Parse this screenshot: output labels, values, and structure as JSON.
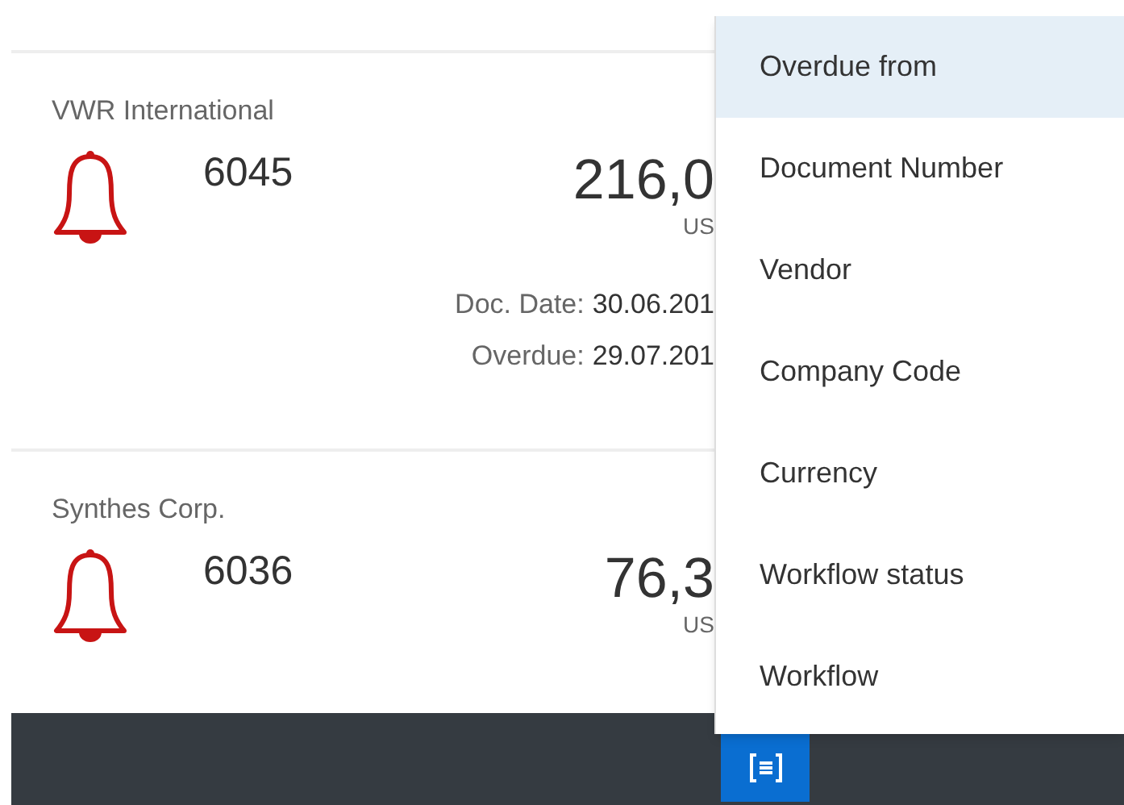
{
  "items": [
    {
      "vendor": "VWR International",
      "number": "6045",
      "amount": "216,0",
      "currency": "US",
      "details": [
        {
          "label": "Doc. Date:",
          "value": "30.06.201"
        },
        {
          "label": "Overdue:",
          "value": "29.07.201"
        }
      ]
    },
    {
      "vendor": "Synthes Corp.",
      "number": "6036",
      "amount": "76,3",
      "currency": "US"
    }
  ],
  "sort_menu": {
    "items": [
      {
        "label": "Overdue from",
        "selected": true
      },
      {
        "label": "Document Number",
        "selected": false
      },
      {
        "label": "Vendor",
        "selected": false
      },
      {
        "label": "Company Code",
        "selected": false
      },
      {
        "label": "Currency",
        "selected": false
      },
      {
        "label": "Workflow status",
        "selected": false
      },
      {
        "label": "Workflow",
        "selected": false
      }
    ]
  }
}
